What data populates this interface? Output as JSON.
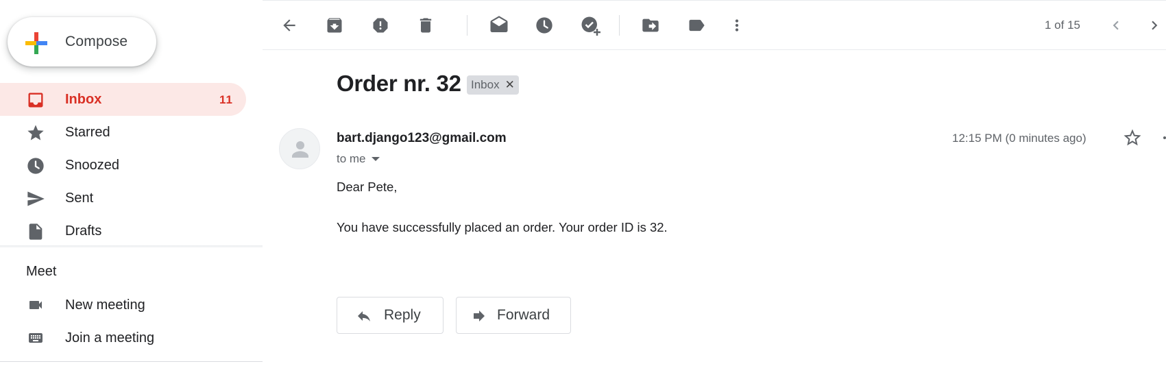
{
  "compose": {
    "label": "Compose"
  },
  "nav": [
    {
      "label": "Inbox",
      "count": "11",
      "icon": "inbox-icon"
    },
    {
      "label": "Starred",
      "icon": "star-icon"
    },
    {
      "label": "Snoozed",
      "icon": "clock-icon"
    },
    {
      "label": "Sent",
      "icon": "send-icon"
    },
    {
      "label": "Drafts",
      "icon": "draft-icon"
    }
  ],
  "meet": {
    "title": "Meet",
    "items": [
      {
        "label": "New meeting",
        "icon": "video-icon"
      },
      {
        "label": "Join a meeting",
        "icon": "keyboard-icon"
      }
    ]
  },
  "toolbar": {
    "icons": [
      "back-arrow-icon",
      "archive-icon",
      "report-spam-icon",
      "delete-icon",
      "mark-unread-icon",
      "snooze-icon",
      "add-task-icon",
      "move-to-icon",
      "label-icon",
      "more-vert-icon"
    ],
    "pager": "1 of 15"
  },
  "message": {
    "subject": "Order nr. 32",
    "label_chip": "Inbox",
    "sender": "bart.django123@gmail.com",
    "to": "to me",
    "timestamp": "12:15 PM (0 minutes ago)",
    "body": [
      "Dear Pete,",
      "You have successfully placed an order. Your order ID is 32."
    ],
    "reply_label": "Reply",
    "forward_label": "Forward"
  },
  "colors": {
    "accent_red": "#d93025",
    "active_bg": "#fce8e6",
    "icon_gray": "#5f6368"
  }
}
